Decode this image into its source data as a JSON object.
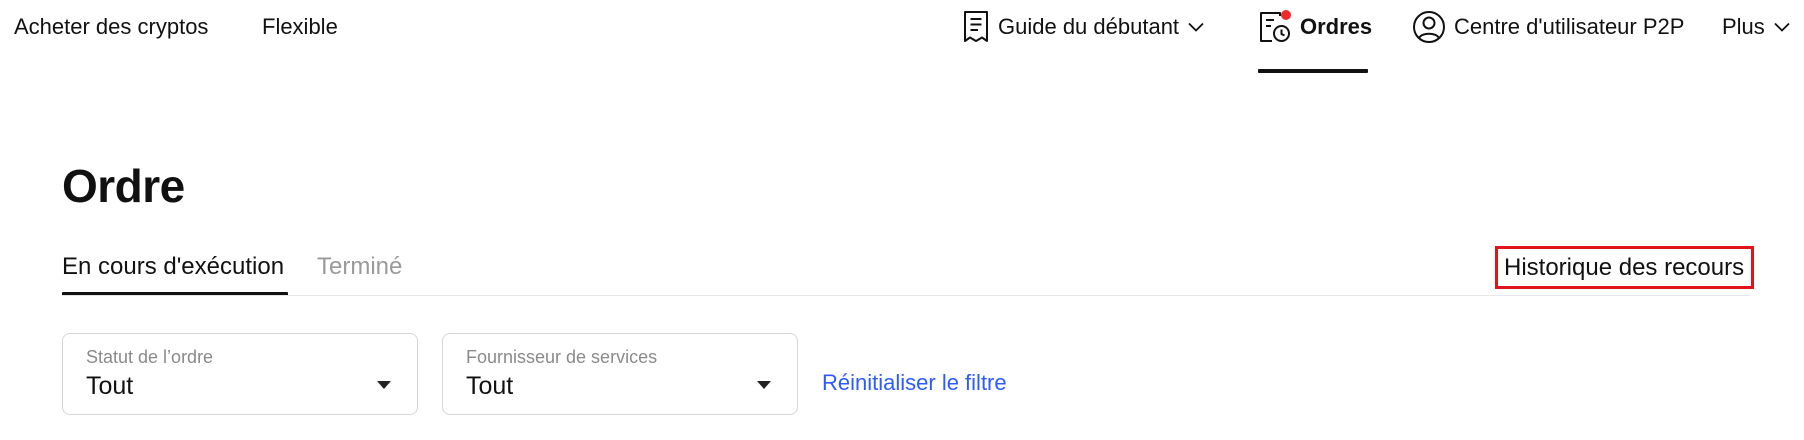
{
  "nav": {
    "buy_crypto": "Acheter des cryptos",
    "flexible": "Flexible",
    "guide": "Guide du débutant",
    "orders": "Ordres",
    "user_center": "Centre d'utilisateur P2P",
    "more": "Plus"
  },
  "page": {
    "title": "Ordre"
  },
  "tabs": [
    {
      "label": "En cours d'exécution",
      "active": true
    },
    {
      "label": "Terminé",
      "active": false
    }
  ],
  "history_link": "Historique des recours",
  "filters": {
    "status": {
      "label": "Statut de l’ordre",
      "value": "Tout"
    },
    "provider": {
      "label": "Fournisseur de services",
      "value": "Tout"
    },
    "reset": "Réinitialiser le filtre"
  },
  "colors": {
    "notification_dot": "#f0292a",
    "highlight_border": "#e0141b",
    "link_blue": "#2e5bff",
    "inactive_tab": "#9a9a9a"
  }
}
